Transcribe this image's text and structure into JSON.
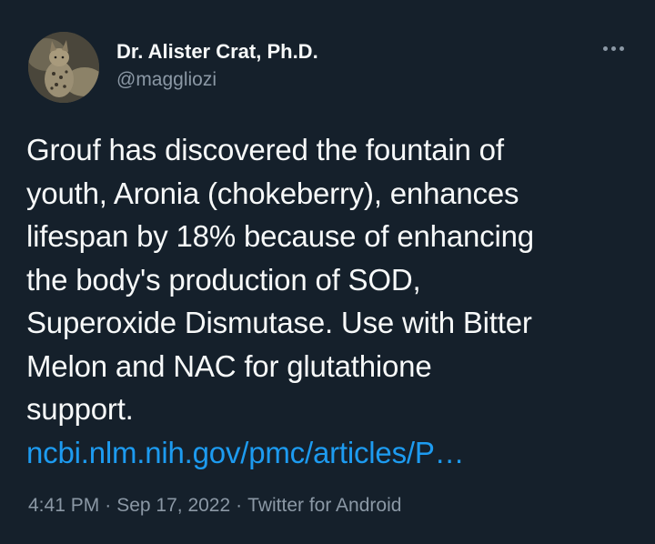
{
  "author": {
    "display_name": "Dr. Alister Crat, Ph.D.",
    "handle": "@maggliozi",
    "avatar_icon": "cat-avatar"
  },
  "menu": {
    "icon": "more-horizontal-icon"
  },
  "tweet": {
    "lines": [
      "Grouf has discovered the fountain of",
      "youth, Aronia (chokeberry), enhances",
      "lifespan by 18% because of enhancing",
      "the body's production of SOD,",
      "Superoxide Dismutase. Use with Bitter",
      "Melon and NAC for glutathione",
      "support."
    ],
    "link": "ncbi.nlm.nih.gov/pmc/articles/P…"
  },
  "meta": {
    "time": "4:41 PM",
    "separator": "·",
    "date": "Sep 17, 2022",
    "client": "Twitter for Android"
  },
  "colors": {
    "background": "#15202b",
    "text": "#f7f9f9",
    "secondary_text": "#8b98a5",
    "link": "#1d9bf0"
  }
}
